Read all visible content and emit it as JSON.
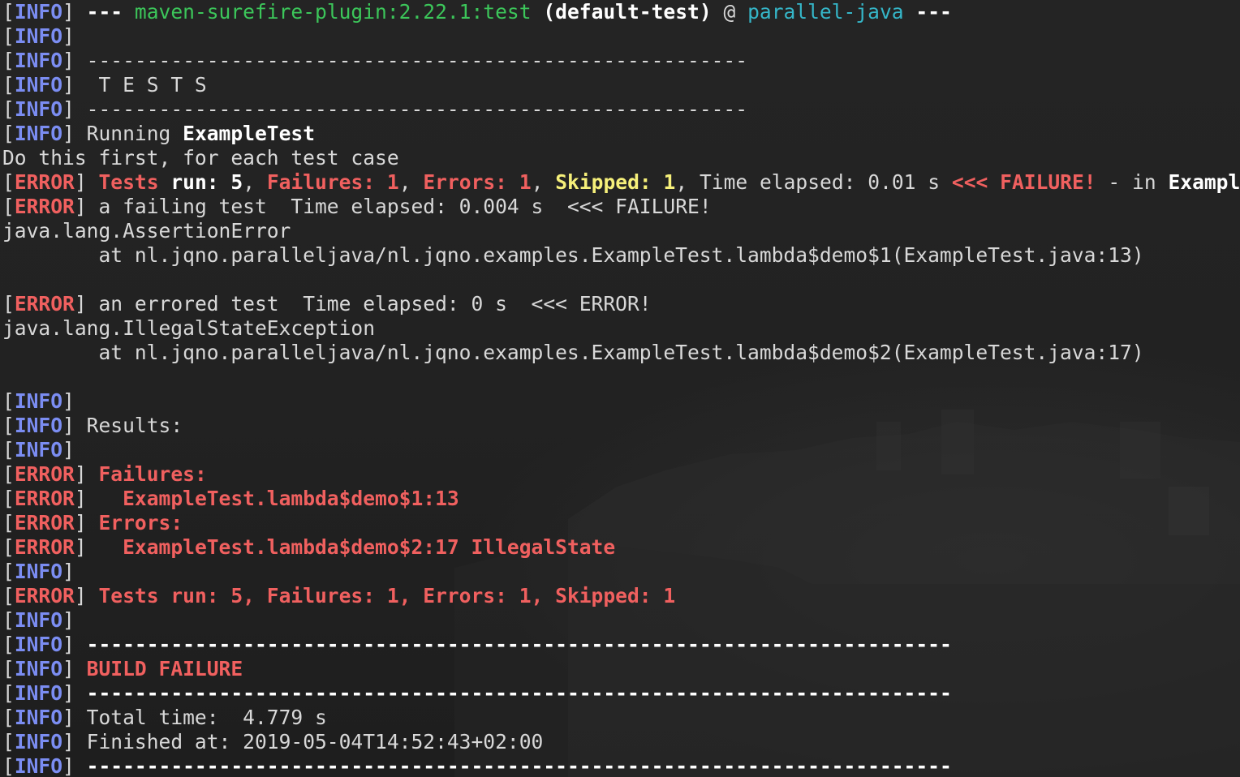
{
  "terminal": {
    "colors": {
      "background": "#232323",
      "text": "#d8d8d8",
      "info_label": "#7b8df2",
      "error": "#f0605f",
      "skipped": "#f6f07a",
      "plugin": "#3cc65a",
      "project": "#35b6c8"
    },
    "labels": {
      "info": "INFO",
      "error": "ERROR",
      "open_bracket": "[",
      "close_bracket": "]"
    },
    "lines": {
      "l1": {
        "dashes_start": "---",
        "plugin": "maven-surefire-plugin:2.22.1:test",
        "execution": "(default-test)",
        "at": "@",
        "project": "parallel-java",
        "dashes_end": "---"
      },
      "l3": {
        "text": "-------------------------------------------------------"
      },
      "l4": {
        "text": " T E S T S"
      },
      "l5": {
        "text": "-------------------------------------------------------"
      },
      "l6": {
        "prefix": "Running ",
        "class": "ExampleTest"
      },
      "l7": {
        "text": "Do this first, for each test case"
      },
      "l8": {
        "tests_run_label": "Tests",
        "run_label": "run:",
        "run_value": "5",
        "failures_label": "Failures:",
        "failures_value": "1",
        "errors_label": "Errors:",
        "errors_value": "1",
        "skipped_label": "Skipped:",
        "skipped_value": "1",
        "elapsed": "Time elapsed: 0.01 s",
        "marker": "<<< FAILURE!",
        "in_text": " - in ",
        "class": "ExampleTest"
      },
      "l9": {
        "text": "a failing test  Time elapsed: 0.004 s  <<< FAILURE!"
      },
      "l10": {
        "text": "java.lang.AssertionError"
      },
      "l11": {
        "text": "        at nl.jqno.paralleljava/nl.jqno.examples.ExampleTest.lambda$demo$1(ExampleTest.java:13)"
      },
      "l13": {
        "text": "an errored test  Time elapsed: 0 s  <<< ERROR!"
      },
      "l14": {
        "text": "java.lang.IllegalStateException"
      },
      "l15": {
        "text": "        at nl.jqno.paralleljava/nl.jqno.examples.ExampleTest.lambda$demo$2(ExampleTest.java:17)"
      },
      "l18": {
        "text": "Results:"
      },
      "l20": {
        "text": "Failures:"
      },
      "l21": {
        "text": "  ExampleTest.lambda$demo$1:13"
      },
      "l22": {
        "text": "Errors:"
      },
      "l23": {
        "text": "  ExampleTest.lambda$demo$2:17 IllegalState"
      },
      "l25": {
        "text": "Tests run: 5, Failures: 1, Errors: 1, Skipped: 1"
      },
      "l27": {
        "text": "------------------------------------------------------------------------"
      },
      "l28": {
        "text": "BUILD FAILURE"
      },
      "l29": {
        "text": "------------------------------------------------------------------------"
      },
      "l30": {
        "text": "Total time:  4.779 s"
      },
      "l31": {
        "text": "Finished at: 2019-05-04T14:52:43+02:00"
      },
      "l32": {
        "text": "------------------------------------------------------------------------"
      }
    }
  }
}
